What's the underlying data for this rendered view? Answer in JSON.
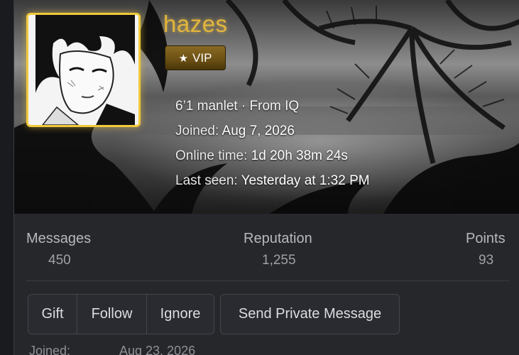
{
  "profile": {
    "username": "hazes",
    "badge": {
      "label": "VIP",
      "icon": "star-icon"
    },
    "about": "6’1 manlet · From IQ",
    "joined": {
      "label": "Joined:",
      "value": "Aug 7, 2026"
    },
    "online": {
      "label": "Online time:",
      "value": "1d 20h 38m 24s"
    },
    "last_seen": {
      "label": "Last seen:",
      "value": "Yesterday at 1:32 PM"
    }
  },
  "stats": [
    {
      "label": "Messages",
      "value": "450"
    },
    {
      "label": "Reputation",
      "value": "1,255"
    },
    {
      "label": "Points",
      "value": "93"
    }
  ],
  "actions": {
    "gift": "Gift",
    "follow": "Follow",
    "ignore": "Ignore",
    "private_message": "Send Private Message"
  },
  "next_row": {
    "label": "Joined:",
    "value": "Aug 23, 2026"
  },
  "colors": {
    "username": "#e2b53c",
    "avatar_border": "#f0c93c",
    "card_bg": "#26272b"
  }
}
